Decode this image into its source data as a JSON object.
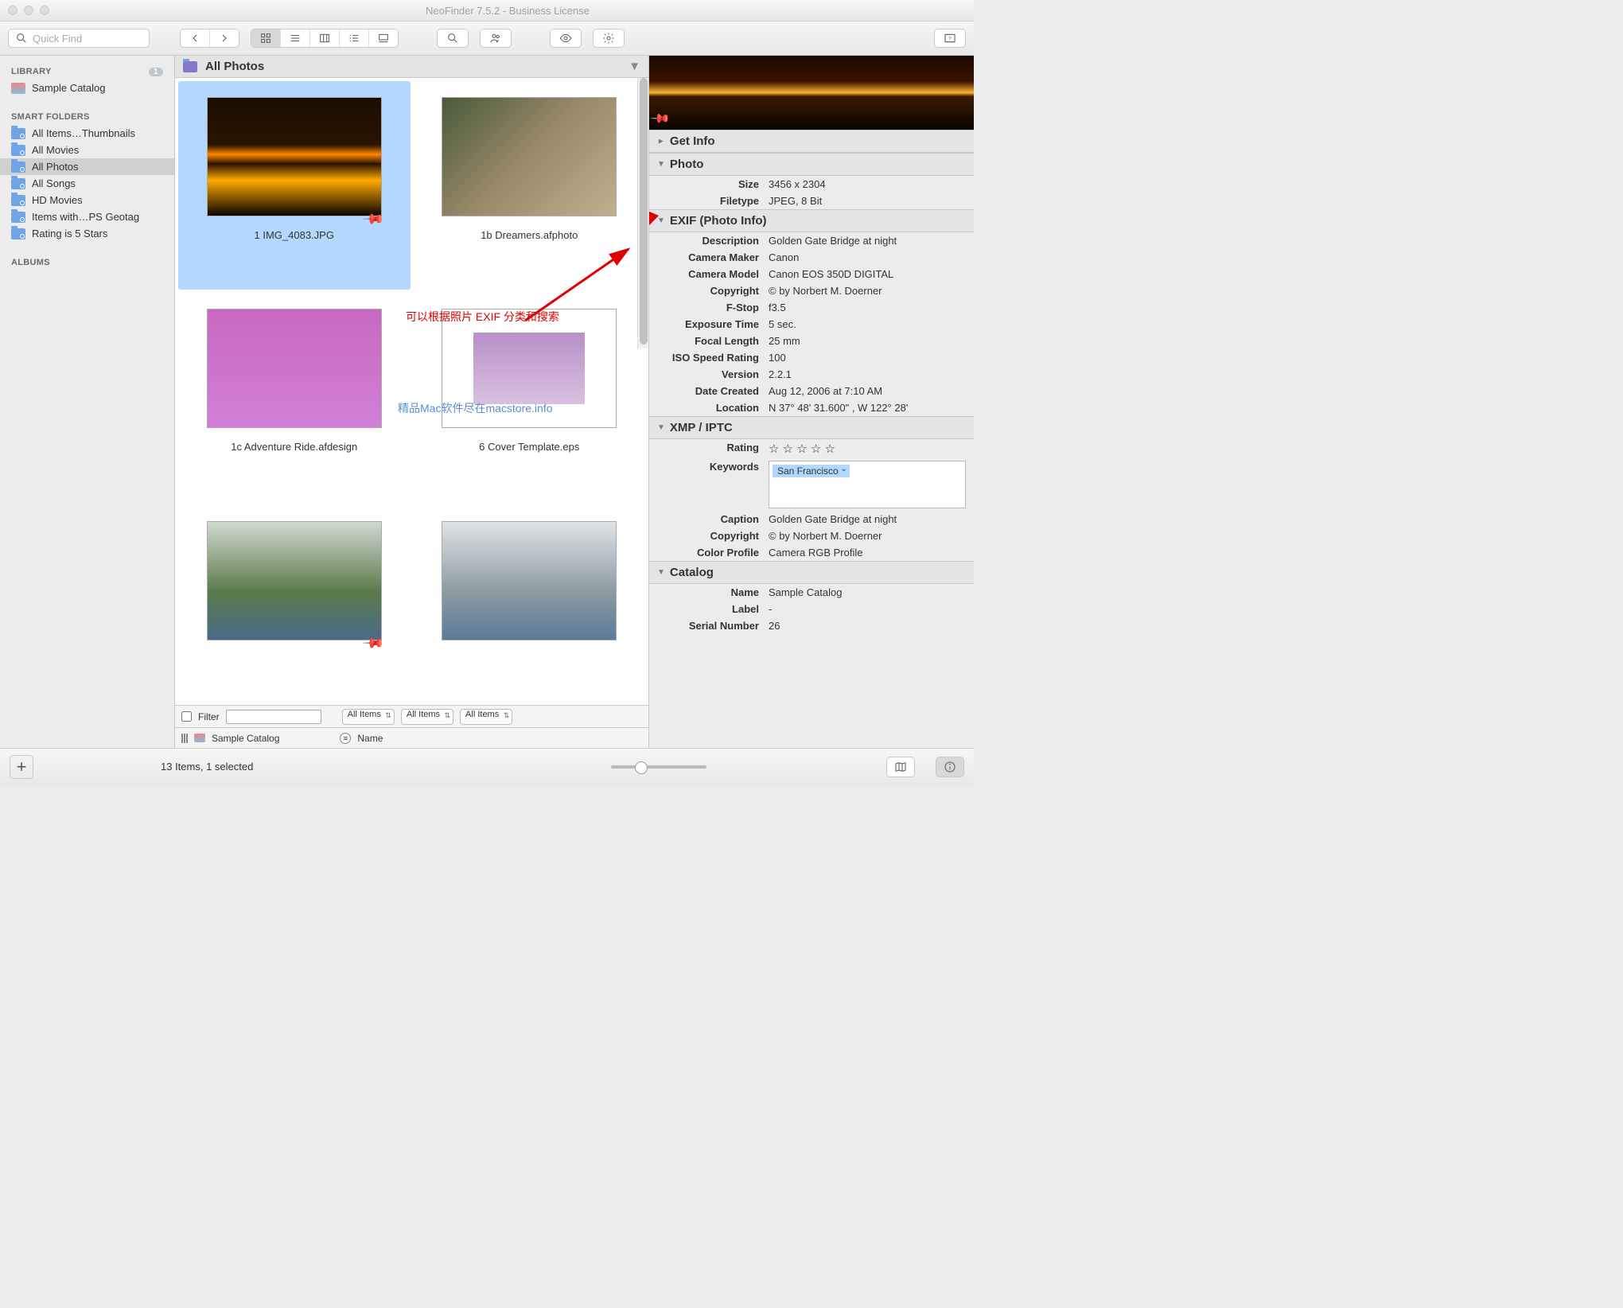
{
  "window": {
    "title": "NeoFinder 7.5.2 - Business License"
  },
  "toolbar": {
    "quickfind_placeholder": "Quick Find"
  },
  "sidebar": {
    "library_label": "LIBRARY",
    "library_badge": "1",
    "catalog": "Sample Catalog",
    "smart_label": "SMART FOLDERS",
    "smart_items": [
      "All Items…Thumbnails",
      "All Movies",
      "All Photos",
      "All Songs",
      "HD Movies",
      "Items with…PS Geotag",
      "Rating is 5 Stars"
    ],
    "albums_label": "ALBUMS"
  },
  "content": {
    "header": "All Photos",
    "annotation_text": "可以根据照片 EXIF 分类和搜索",
    "watermark": "精品Mac软件尽在macstore.info",
    "items": [
      "1 IMG_4083.JPG",
      "1b Dreamers.afphoto",
      "1c Adventure Ride.afdesign",
      "6 Cover Template.eps",
      "",
      ""
    ]
  },
  "filter": {
    "label": "Filter",
    "sel1": "All Items",
    "sel2": "All Items",
    "sel3": "All Items"
  },
  "pathbar": {
    "catalog": "Sample Catalog",
    "col_name": "Name"
  },
  "inspector": {
    "get_info": "Get Info",
    "photo": "Photo",
    "photo_rows": [
      {
        "k": "Size",
        "v": "3456 x 2304"
      },
      {
        "k": "Filetype",
        "v": "JPEG, 8 Bit"
      }
    ],
    "exif": "EXIF (Photo Info)",
    "exif_rows": [
      {
        "k": "Description",
        "v": "Golden Gate Bridge at night"
      },
      {
        "k": "Camera Maker",
        "v": "Canon"
      },
      {
        "k": "Camera Model",
        "v": "Canon EOS 350D DIGITAL"
      },
      {
        "k": "Copyright",
        "v": "© by Norbert M. Doerner"
      },
      {
        "k": "F-Stop",
        "v": "f3.5"
      },
      {
        "k": "Exposure Time",
        "v": "5 sec."
      },
      {
        "k": "Focal Length",
        "v": "25 mm"
      },
      {
        "k": "ISO Speed Rating",
        "v": "100"
      },
      {
        "k": "Version",
        "v": "2.2.1"
      },
      {
        "k": "Date Created",
        "v": "Aug 12, 2006 at 7:10 AM"
      },
      {
        "k": "Location",
        "v": "N 37° 48' 31.600\" , W 122° 28'"
      }
    ],
    "xmp": "XMP / IPTC",
    "rating_label": "Rating",
    "keywords_label": "Keywords",
    "keyword_tag": "San Francisco",
    "xmp_rows": [
      {
        "k": "Caption",
        "v": "Golden Gate Bridge at night"
      },
      {
        "k": "Copyright",
        "v": "© by Norbert M. Doerner"
      },
      {
        "k": "Color Profile",
        "v": "Camera RGB Profile"
      }
    ],
    "catalog": "Catalog",
    "catalog_rows": [
      {
        "k": "Name",
        "v": "Sample Catalog"
      },
      {
        "k": "Label",
        "v": "-"
      },
      {
        "k": "Serial Number",
        "v": "26"
      }
    ]
  },
  "status": {
    "text": "13 Items, 1 selected"
  }
}
